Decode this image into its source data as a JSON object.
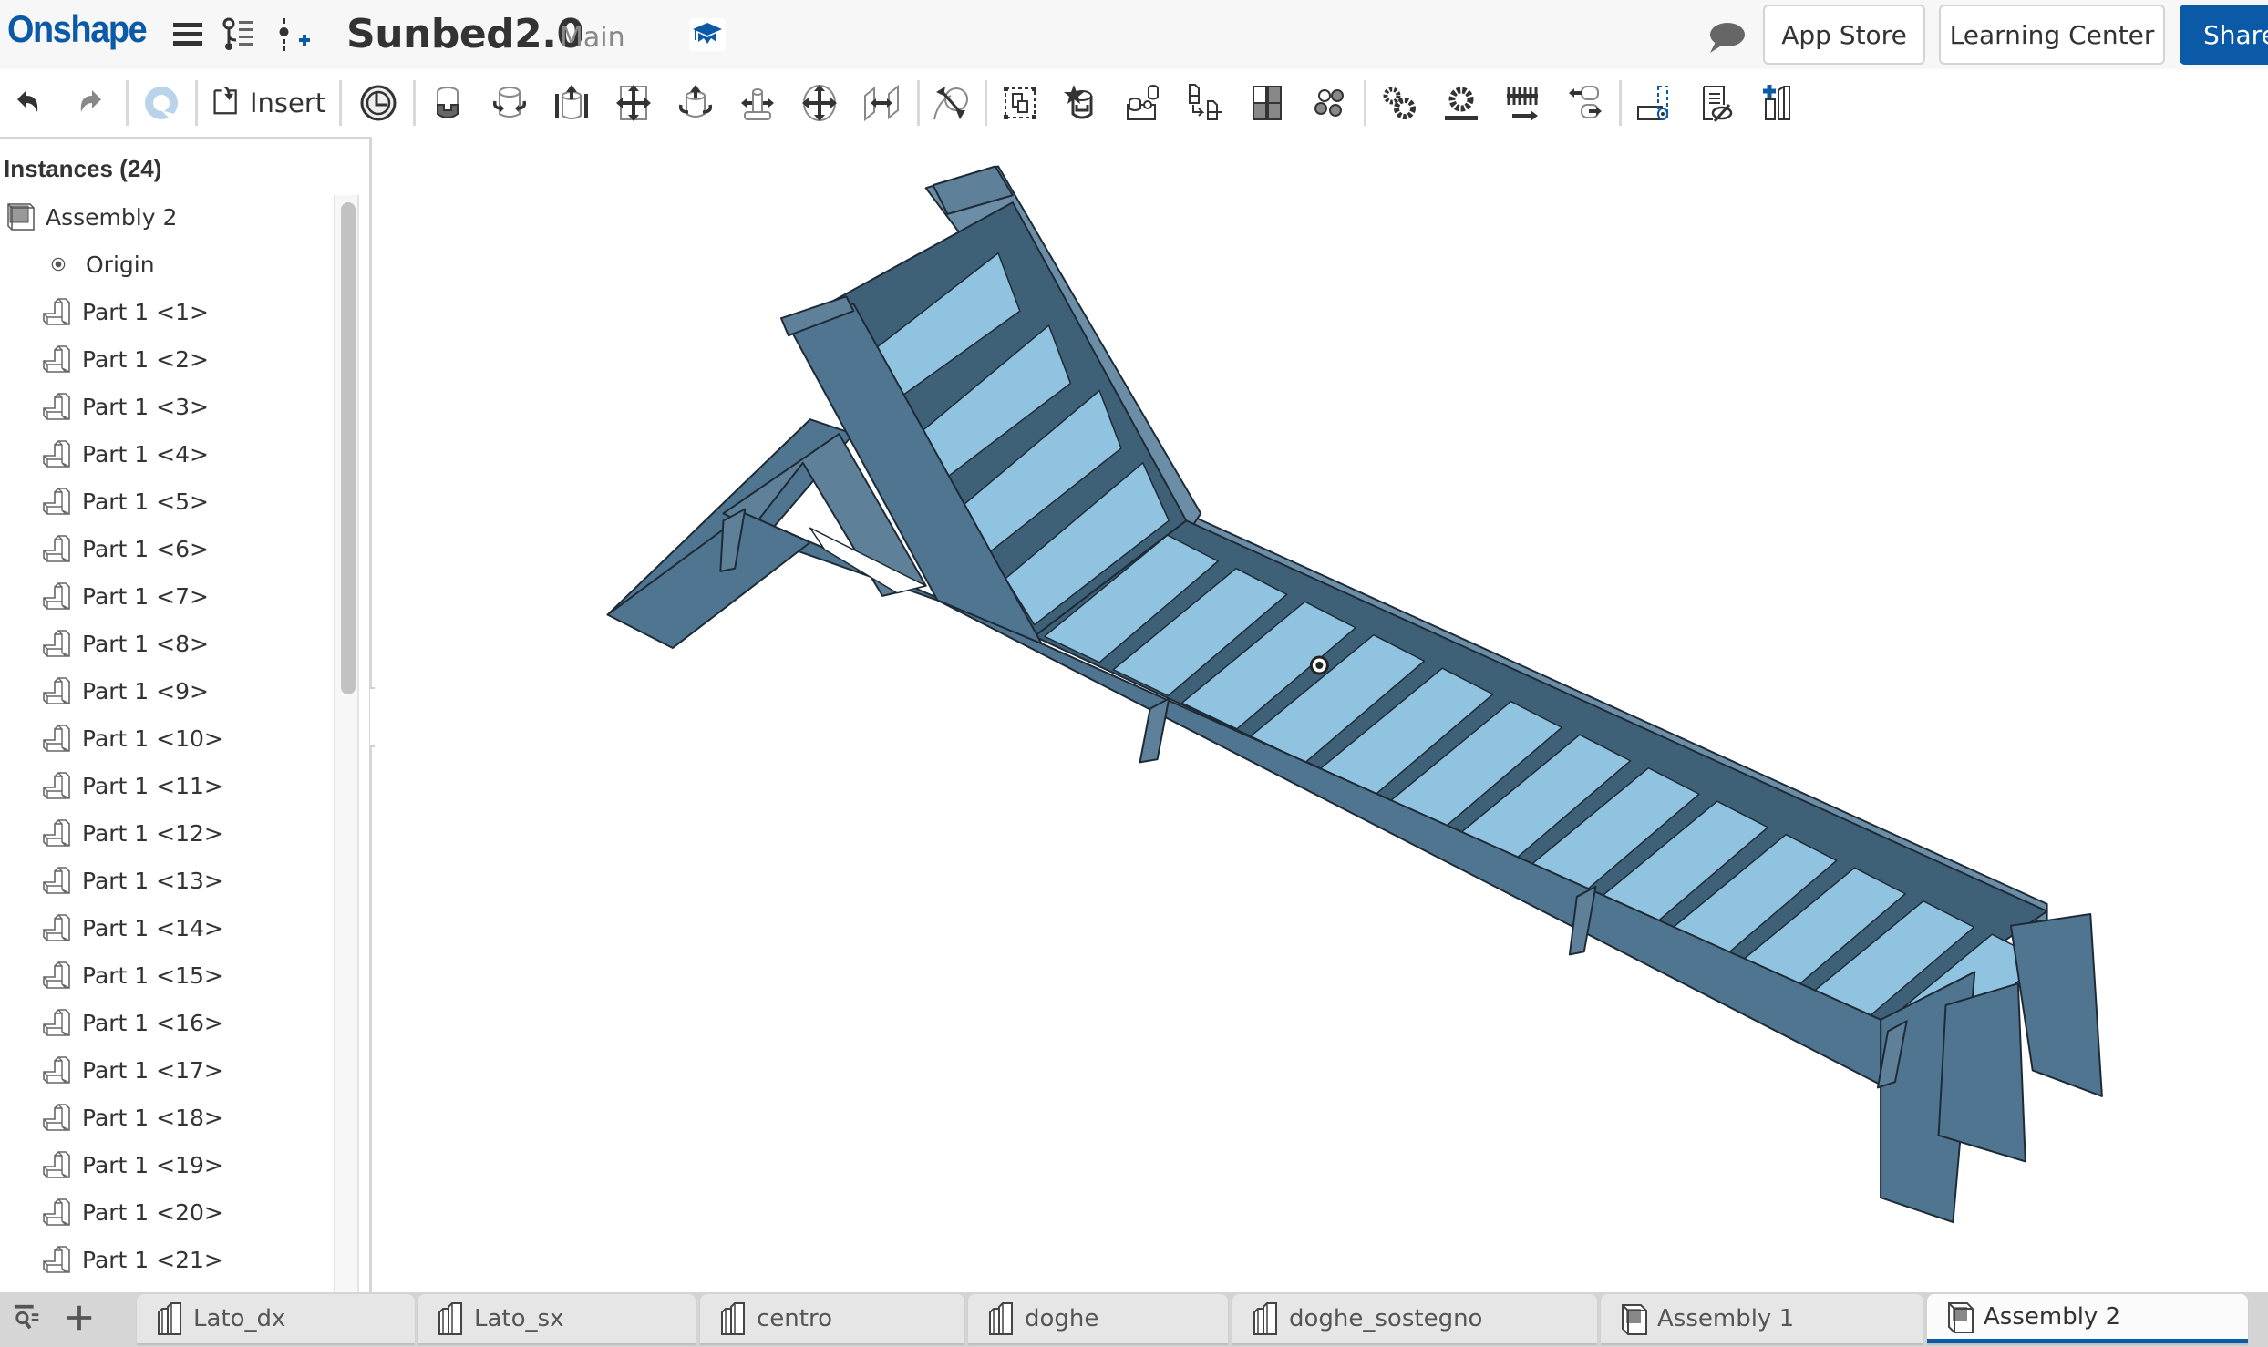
{
  "header": {
    "logo": "Onshape",
    "document_title": "Sunbed2.0",
    "branch": "Main",
    "app_store_label": "App Store",
    "learning_center_label": "Learning Center",
    "share_label": "Share",
    "icons": [
      "menu-icon",
      "versions-graph-icon",
      "branch-add-icon",
      "education-icon",
      "comments-icon"
    ]
  },
  "toolbar": {
    "insert_label": "Insert",
    "tools": [
      "undo",
      "redo",
      "regenerate",
      "insert",
      "named-positions",
      "fastened-mate",
      "revolute-mate",
      "slider-mate",
      "planar-mate",
      "cylindrical-mate",
      "pin-slot-mate",
      "ball-mate",
      "parallel-mate",
      "tangent-mate",
      "group",
      "replicate",
      "mate-connector",
      "replace-instance",
      "linear-pattern",
      "circular-pattern",
      "gear-relation",
      "rack-pinion-relation",
      "screw-relation",
      "linear-relation",
      "explode",
      "display-states",
      "insert-part"
    ]
  },
  "sidebar": {
    "title": "Instances (24)",
    "root": "Assembly 2",
    "origin": "Origin",
    "items": [
      "Part 1 <1>",
      "Part 1 <2>",
      "Part 1 <3>",
      "Part 1 <4>",
      "Part 1 <5>",
      "Part 1 <6>",
      "Part 1 <7>",
      "Part 1 <8>",
      "Part 1 <9>",
      "Part 1 <10>",
      "Part 1 <11>",
      "Part 1 <12>",
      "Part 1 <13>",
      "Part 1 <14>",
      "Part 1 <15>",
      "Part 1 <16>",
      "Part 1 <17>",
      "Part 1 <18>",
      "Part 1 <19>",
      "Part 1 <20>",
      "Part 1 <21>"
    ]
  },
  "viewport": {
    "model": "sunbed assembly",
    "colors": {
      "frame": "#4f7590",
      "slat": "#8fc3e0",
      "edge": "#1e2b36"
    }
  },
  "tabs": [
    {
      "label": "Lato_dx",
      "type": "part-studio",
      "active": false
    },
    {
      "label": "Lato_sx",
      "type": "part-studio",
      "active": false
    },
    {
      "label": "centro",
      "type": "part-studio",
      "active": false
    },
    {
      "label": "doghe",
      "type": "part-studio",
      "active": false
    },
    {
      "label": "doghe_sostegno",
      "type": "part-studio",
      "active": false
    },
    {
      "label": "Assembly 1",
      "type": "assembly",
      "active": false
    },
    {
      "label": "Assembly 2",
      "type": "assembly",
      "active": true
    }
  ],
  "colors": {
    "brand": "#0a5aa8",
    "header_bg": "#f7f7f7",
    "tab_bar_bg": "#d4d4d4"
  }
}
